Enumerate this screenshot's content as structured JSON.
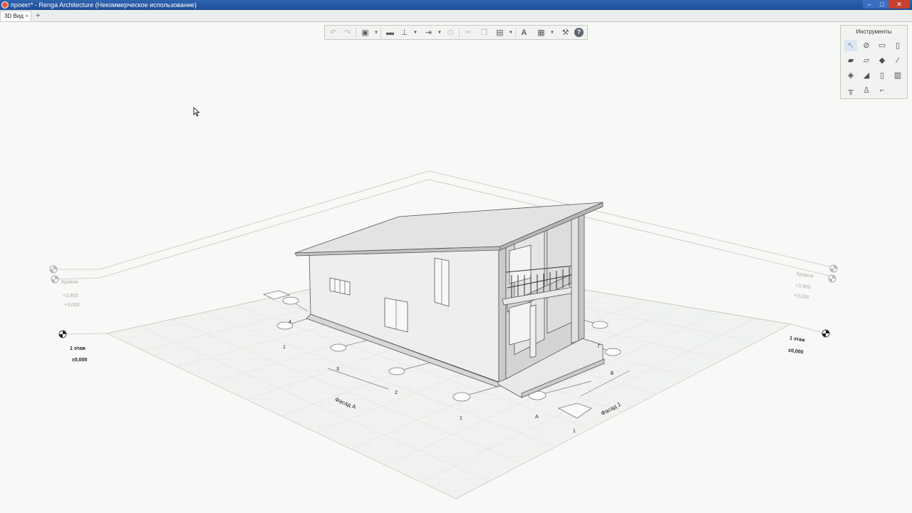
{
  "window": {
    "title": "проект* - Renga Architecture (Некоммерческое использование)"
  },
  "controls": {
    "minimize": "‒",
    "maximize": "□",
    "close": "✕"
  },
  "tabs": [
    {
      "label": "3D Вид",
      "close": "×"
    }
  ],
  "add_tab": "+",
  "tools_panel": {
    "title": "Инструменты"
  },
  "levels": {
    "roof": {
      "name": "Кровля",
      "elev1": "+3,900",
      "elev2": "+3,000"
    },
    "floor1": {
      "name": "1 этаж",
      "elev": "±0,000"
    }
  },
  "facades": {
    "a": "Фасад А",
    "one": "Фасад 1"
  },
  "axes": {
    "numbers": [
      "1",
      "2",
      "3",
      "4"
    ],
    "letters": [
      "А",
      "Б",
      "В",
      "Г"
    ]
  },
  "colors": {
    "titlebar": "#2a5ca8",
    "close": "#c8402f",
    "background": "#f7f9f6",
    "selected_tool": "#dde7f2"
  }
}
